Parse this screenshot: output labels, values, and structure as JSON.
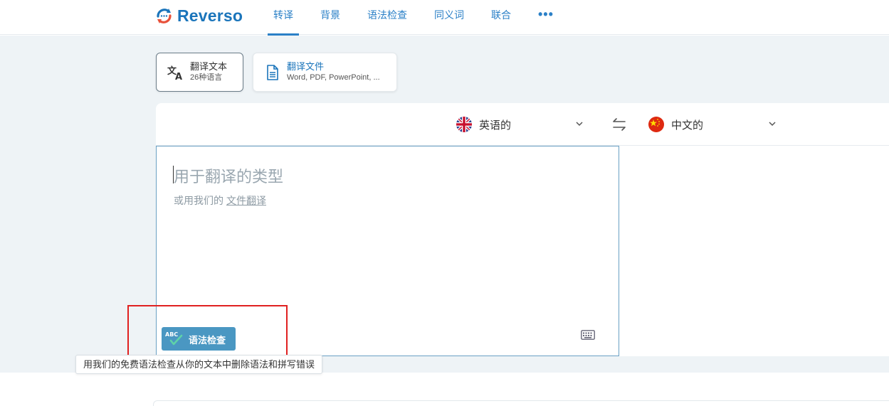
{
  "header": {
    "brand": "Reverso",
    "nav": [
      {
        "label": "转译",
        "active": true
      },
      {
        "label": "背景",
        "active": false
      },
      {
        "label": "语法检查",
        "active": false
      },
      {
        "label": "同义词",
        "active": false
      },
      {
        "label": "联合",
        "active": false
      }
    ],
    "more_label": "•••"
  },
  "modes": {
    "text": {
      "title": "翻译文本",
      "subtitle": "26种语言",
      "icon": "translate-icon"
    },
    "file": {
      "title": "翻译文件",
      "subtitle": "Word, PDF, PowerPoint, ...",
      "icon": "document-icon"
    }
  },
  "languages": {
    "source": {
      "label": "英语的",
      "flag": "uk-flag"
    },
    "target": {
      "label": "中文的",
      "flag": "china-flag"
    }
  },
  "source_box": {
    "placeholder": "用于翻译的类型",
    "hint_prefix": "或用我们的",
    "hint_link": "文件翻译"
  },
  "grammar_check": {
    "icon_text": "ABC",
    "label": "语法检查",
    "tooltip": "用我们的免费语法检查从你的文本中删除语法和拼写错误"
  },
  "colors": {
    "brand": "#1b75bb",
    "link": "#2b80c7",
    "grammar_button": "#4a97c2",
    "highlight": "#e02020",
    "band": "#eef3f6"
  }
}
